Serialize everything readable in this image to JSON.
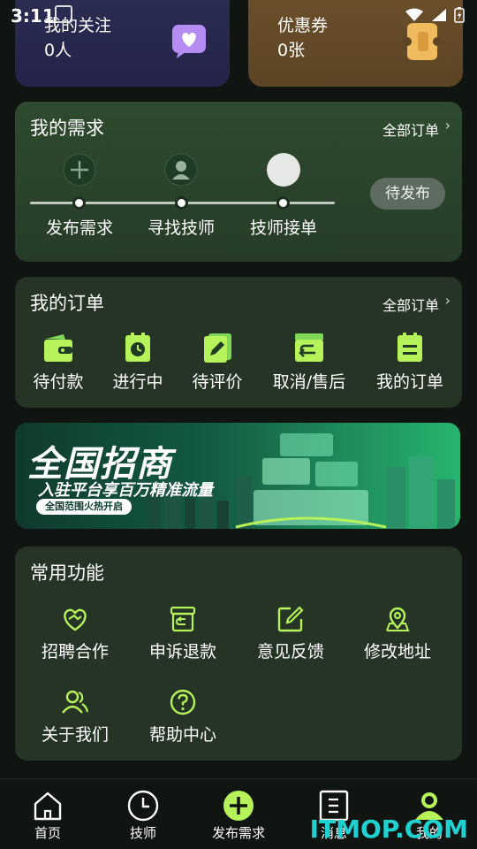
{
  "status_bar": {
    "time": "3:11"
  },
  "top_cards": {
    "follow": {
      "title": "我的关注",
      "value": "0人"
    },
    "coupon": {
      "title": "优惠券",
      "value": "0张"
    }
  },
  "demand": {
    "title": "我的需求",
    "all_orders_link": "全部订单",
    "steps": [
      {
        "label": "发布需求",
        "icon": "add-circle-icon"
      },
      {
        "label": "寻找技师",
        "icon": "technician-avatar-icon"
      },
      {
        "label": "技师接单",
        "icon": "accept-circle-icon"
      }
    ],
    "pending_button": "待发布"
  },
  "orders": {
    "title": "我的订单",
    "all_orders_link": "全部订单",
    "items": [
      {
        "label": "待付款",
        "icon": "wallet-icon"
      },
      {
        "label": "进行中",
        "icon": "clock-clipboard-icon"
      },
      {
        "label": "待评价",
        "icon": "edit-note-icon"
      },
      {
        "label": "取消/售后",
        "icon": "return-box-icon"
      },
      {
        "label": "我的订单",
        "icon": "order-list-icon"
      }
    ]
  },
  "banner": {
    "title": "全国招商",
    "subtitle": "入驻平台享百万精准流量",
    "pill": "全国范围火热开启"
  },
  "functions": {
    "title": "常用功能",
    "items": [
      {
        "label": "招聘合作",
        "icon": "handshake-heart-icon"
      },
      {
        "label": "申诉退款",
        "icon": "refund-box-icon"
      },
      {
        "label": "意见反馈",
        "icon": "feedback-edit-icon"
      },
      {
        "label": "修改地址",
        "icon": "map-pin-icon"
      },
      {
        "label": "关于我们",
        "icon": "people-icon"
      },
      {
        "label": "帮助中心",
        "icon": "help-circle-icon"
      }
    ]
  },
  "tabbar": {
    "items": [
      {
        "label": "首页",
        "icon": "home-icon"
      },
      {
        "label": "技师",
        "icon": "clock-icon"
      },
      {
        "label": "发布需求",
        "icon": "plus-circle-icon"
      },
      {
        "label": "消息",
        "icon": "message-doc-icon"
      },
      {
        "label": "我的",
        "icon": "profile-icon"
      }
    ],
    "active": "我的"
  },
  "watermark": "ITMOP.COM",
  "colors": {
    "accent_green": "#b6f25a",
    "background": "#111511",
    "panel": "#253425"
  }
}
